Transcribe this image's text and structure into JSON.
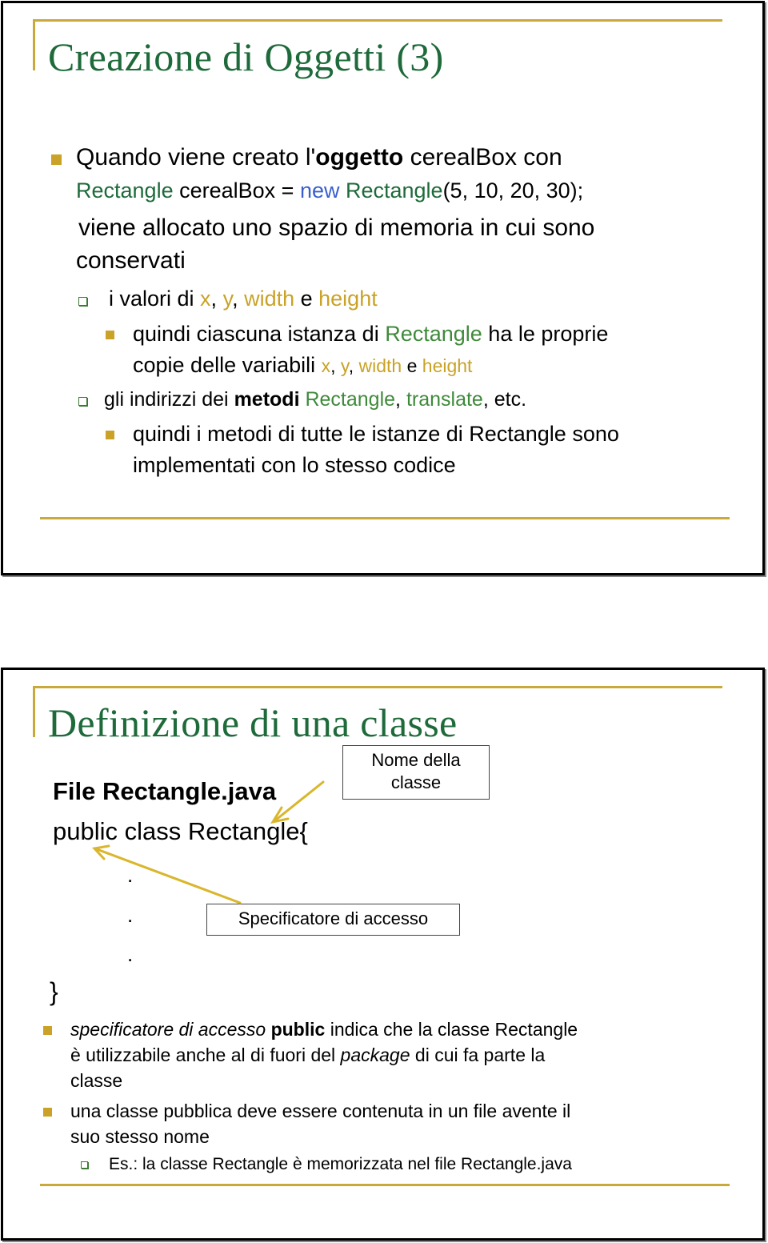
{
  "slide1": {
    "title": "Creazione di Oggetti (3)",
    "bullet1": {
      "p1": "Quando viene creato l'",
      "bold": "oggetto",
      "p2": " cerealBox con",
      "code": {
        "type": "Rectangle",
        "mid": " cerealBox = ",
        "kw": "new",
        "ctor": " Rectangle",
        "args": "(5, 10, 20, 30);"
      },
      "line3": "viene allocato uno spazio di memoria in cui sono",
      "line4": "conservati"
    },
    "sub1": {
      "prefix": "i valori di ",
      "x": "x",
      "c1": ", ",
      "y": "y",
      "c2": ", ",
      "w": "width",
      "e": " e ",
      "h": "height"
    },
    "sub1a": {
      "p1": "quindi ciascuna istanza di ",
      "rect": "Rectangle",
      "p2": " ha le proprie",
      "line2": "copie delle variabili ",
      "x": "x",
      "c1": ", ",
      "y": "y",
      "c2": ", ",
      "w": "width",
      "e": " e ",
      "h": "height"
    },
    "sub2": {
      "p1": "gli indirizzi dei ",
      "bold": "metodi",
      "sp": " ",
      "rect": "Rectangle",
      "c1": ", ",
      "tr": "translate",
      "p2": ", etc."
    },
    "sub2a": {
      "line1": "quindi i metodi di tutte le istanze di Rectangle sono",
      "line2": "implementati con lo stesso codice"
    }
  },
  "slide2": {
    "title": "Definizione di una classe",
    "file_label": "File Rectangle.java",
    "class_decl": "public class Rectangle{",
    "dots": [
      ".",
      ".",
      "."
    ],
    "closing_brace": "}",
    "callout_name": {
      "line1": "Nome della",
      "line2": "classe"
    },
    "callout_access": "Specificatore di accesso",
    "bullet1": {
      "it1": "specificatore di accesso",
      "sp": " ",
      "bold": "public",
      "p1": " indica che la classe Rectangle",
      "l2a": "è utilizzabile anche al di fuori del ",
      "it2": "package",
      "l2b": " di cui fa parte la",
      "l3": "classe"
    },
    "bullet2": {
      "line1": "una classe pubblica deve essere contenuta in un file avente il",
      "line2": "suo stesso nome"
    },
    "sub1": "Es.: la classe Rectangle è memorizzata nel file Rectangle.java"
  },
  "colors": {
    "title_green": "#1e6a3a",
    "accent_gold": "#c9a227",
    "keyword_blue": "#3a5fcd",
    "method_green": "#3f8a3a"
  }
}
